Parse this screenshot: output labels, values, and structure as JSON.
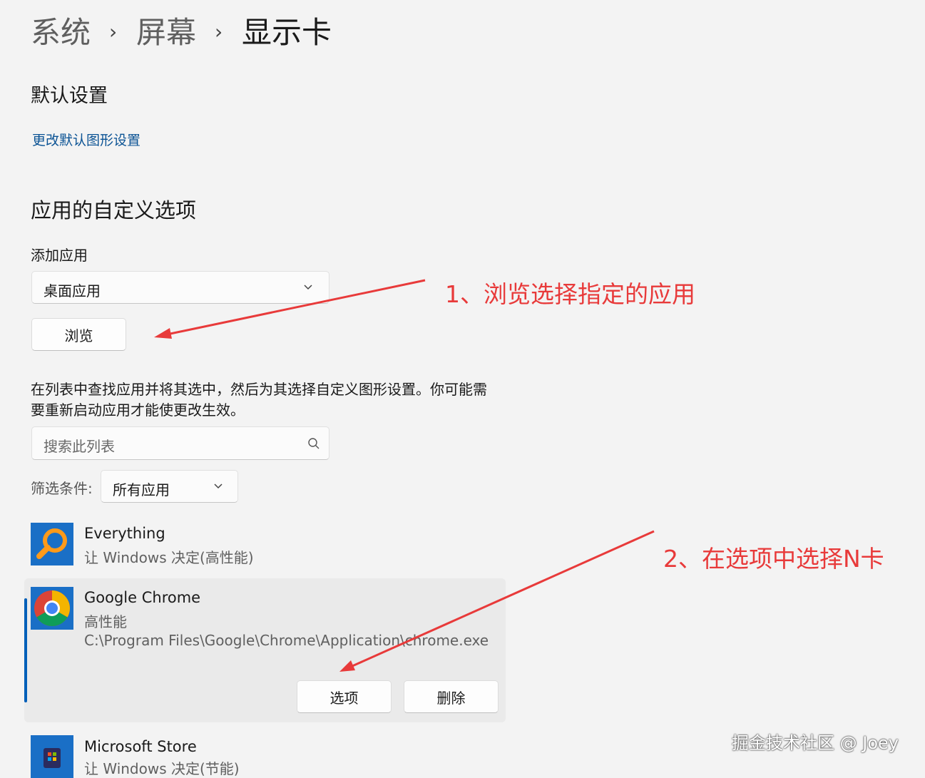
{
  "breadcrumb": {
    "items": [
      "系统",
      "屏幕",
      "显示卡"
    ],
    "separator": "›"
  },
  "defaults": {
    "heading": "默认设置",
    "link": "更改默认图形设置"
  },
  "custom": {
    "heading": "应用的自定义选项",
    "add_label": "添加应用",
    "app_type_value": "桌面应用",
    "browse_label": "浏览",
    "desc_line1": "在列表中查找应用并将其选中，然后为其选择自定义图形设置。你可能需",
    "desc_line2": "要重新启动应用才能使更改生效。",
    "search_placeholder": "搜索此列表",
    "filter_label": "筛选条件:",
    "filter_value": "所有应用"
  },
  "apps": [
    {
      "name": "Everything",
      "pref": "让 Windows 决定(高性能)",
      "icon": "everything-magnifier-icon"
    },
    {
      "name": "Google Chrome",
      "pref": "高性能",
      "path": "C:\\Program Files\\Google\\Chrome\\Application\\chrome.exe",
      "icon": "chrome-icon",
      "options_label": "选项",
      "delete_label": "删除"
    },
    {
      "name": "Microsoft Store",
      "pref": "让 Windows 决定(节能)",
      "icon": "microsoft-store-icon"
    }
  ],
  "annotations": {
    "step1": "1、浏览选择指定的应用",
    "step2": "2、在选项中选择N卡"
  },
  "watermark": "掘金技术社区 @ Joey",
  "colors": {
    "annotation": "#e83a3a",
    "accent": "#005fb8",
    "link": "#0b5394",
    "background": "#f3f3f3"
  }
}
